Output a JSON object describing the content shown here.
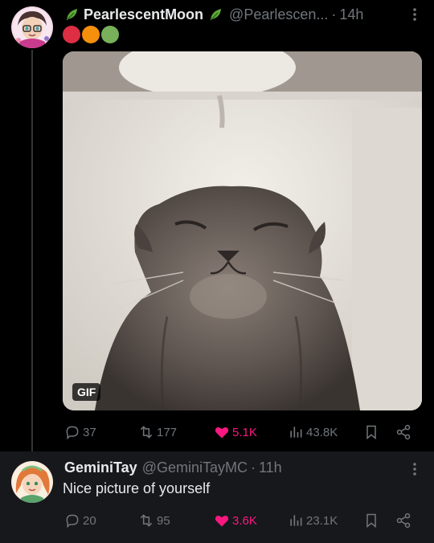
{
  "tweets": [
    {
      "display_name": "PearlescentMoon",
      "handle": "@Pearlescen...",
      "separator": "·",
      "time": "14h",
      "media_badge": "GIF",
      "stats": {
        "replies": "37",
        "reposts": "177",
        "likes": "5.1K",
        "views": "43.8K"
      },
      "liked": true
    },
    {
      "display_name": "GeminiTay",
      "handle": "@GeminiTayMC",
      "separator": "·",
      "time": "11h",
      "text": "Nice picture of yourself",
      "stats": {
        "replies": "20",
        "reposts": "95",
        "likes": "3.6K",
        "views": "23.1K"
      },
      "liked": true
    }
  ],
  "colors": {
    "background": "#000000",
    "reply_background": "#16181c",
    "text": "#e7e9ea",
    "muted": "#71767b",
    "like": "#f91880",
    "leaf": "#5fa83a",
    "circle_red": "#dd2e44",
    "circle_orange": "#f4900c",
    "circle_green": "#78b159"
  },
  "icons": [
    "leaf-icon",
    "more-icon",
    "reply-icon",
    "repost-icon",
    "heart-icon",
    "views-icon",
    "bookmark-icon",
    "share-icon"
  ]
}
